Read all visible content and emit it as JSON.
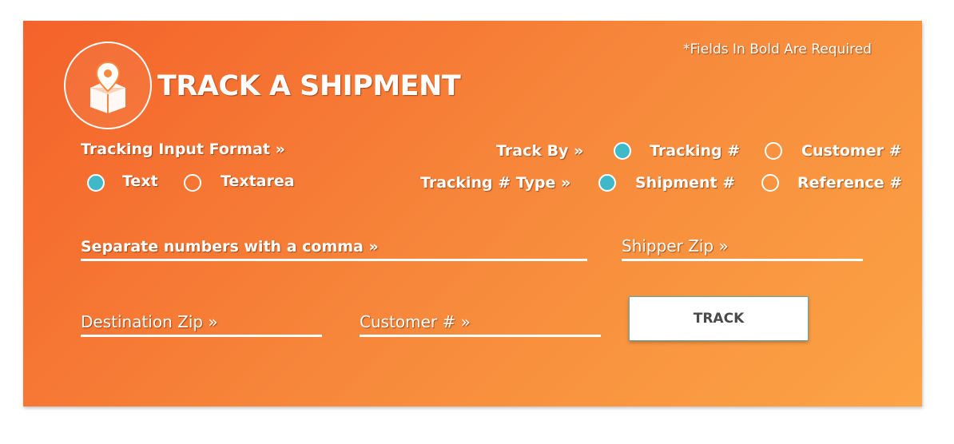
{
  "header": {
    "required_note": "*Fields In Bold Are Required",
    "title": "TRACK A SHIPMENT",
    "logo_icon": "package-location-icon"
  },
  "input_format": {
    "label": "Tracking Input Format »",
    "options": [
      {
        "label": "Text",
        "selected": true
      },
      {
        "label": "Textarea",
        "selected": false
      }
    ]
  },
  "track_by": {
    "label": "Track By »",
    "options": [
      {
        "label": "Tracking #",
        "selected": true
      },
      {
        "label": "Customer #",
        "selected": false
      }
    ]
  },
  "tracking_type": {
    "label": "Tracking # Type »",
    "options": [
      {
        "label": "Shipment #",
        "selected": true
      },
      {
        "label": "Reference #",
        "selected": false
      }
    ]
  },
  "fields": {
    "tracking_numbers": "Separate numbers with a comma »",
    "shipper_zip": "Shipper Zip »",
    "destination_zip": "Destination Zip »",
    "customer_number": "Customer # »"
  },
  "button": {
    "track_label": "TRACK"
  },
  "colors": {
    "gradient_start": "#f4622a",
    "gradient_end": "#fca445",
    "radio_selected": "#3fb8c9",
    "button_text": "#4a4a4a"
  }
}
